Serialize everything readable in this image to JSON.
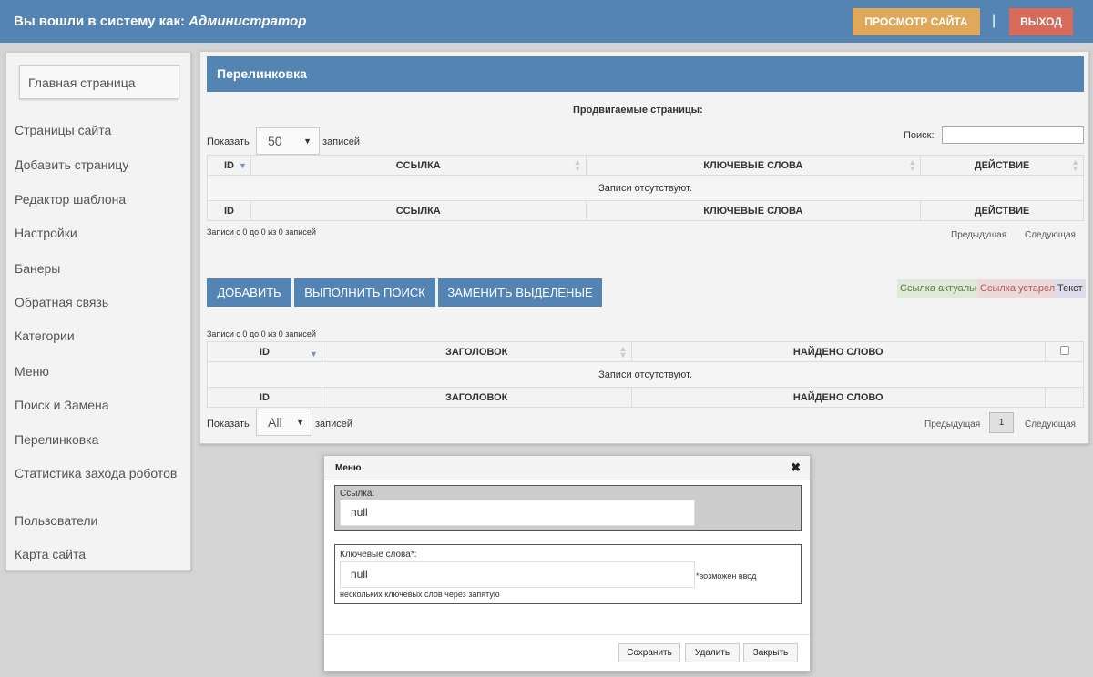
{
  "header": {
    "login_prefix": "Вы вошли в систему как: ",
    "login_user": "Администратор",
    "view_site": "ПРОСМОТР САЙТА",
    "separator": "|",
    "logout": "ВЫХОД"
  },
  "sidebar": {
    "home": "Главная страница",
    "items": [
      {
        "label": "Страницы сайта"
      },
      {
        "label": "Добавить страницу"
      },
      {
        "label": "Редактор шаблона"
      },
      {
        "label": "Настройки"
      },
      {
        "label": "Банеры"
      },
      {
        "label": "Обратная связь"
      },
      {
        "label": "Категории"
      },
      {
        "label": "Меню"
      },
      {
        "label": "Поиск и Замена"
      },
      {
        "label": "Перелинковка"
      },
      {
        "label": "Статистика захода роботов"
      },
      {
        "label": "Пользователи"
      },
      {
        "label": "Карта сайта"
      }
    ]
  },
  "panel": {
    "title": "Перелинковка",
    "section_title": "Продвигаемые страницы:",
    "table1": {
      "show_label": "Показать",
      "show_value": "50",
      "records_label": "записей",
      "search_label": "Поиск:",
      "search_value": "",
      "columns": [
        "ID",
        "ССЫЛКА",
        "КЛЮЧЕВЫЕ СЛОВА",
        "ДЕЙСТВИЕ"
      ],
      "empty": "Записи отсутствуют.",
      "info": "Записи с 0 до 0 из 0 записей",
      "prev": "Предыдущая",
      "next": "Следующая"
    },
    "buttons": {
      "add": "ДОБАВИТЬ",
      "search": "ВЫПОЛНИТЬ ПОИСК",
      "replace": "ЗАМЕНИТЬ ВЫДЕЛЕНЫЕ"
    },
    "legend": {
      "actual": "Ссылка актуальна",
      "outdated": "Ссылка устарела",
      "text": "Текст",
      "actual_bg": "#dfe9d9",
      "outdated_bg": "#ecd9db",
      "text_bg": "#dcdcea"
    },
    "table2": {
      "info": "Записи с 0 до 0 из 0 записей",
      "columns": [
        "ID",
        "ЗАГОЛОВОК",
        "НАЙДЕНО СЛОВО"
      ],
      "empty": "Записи отсутствуют.",
      "show_label": "Показать",
      "show_value": "All",
      "records_label": "записей",
      "prev": "Предыдущая",
      "page": "1",
      "next": "Следующая"
    }
  },
  "modal": {
    "title": "Меню",
    "close": "✖",
    "link_label": "Ссылка:",
    "link_value": "null",
    "keywords_label": "Ключевые слова*:",
    "keywords_value": "null",
    "note_inline": "*возможен ввод",
    "note_line2": "нескольких ключевых слов через запятую",
    "save": "Сохранить",
    "delete": "Удалить",
    "close_btn": "Закрыть"
  },
  "colors": {
    "header_bg": "#5384b4",
    "view_site_bg": "#e0a85a",
    "logout_bg": "#d86a5a",
    "page_bg": "#d4d4d4"
  }
}
